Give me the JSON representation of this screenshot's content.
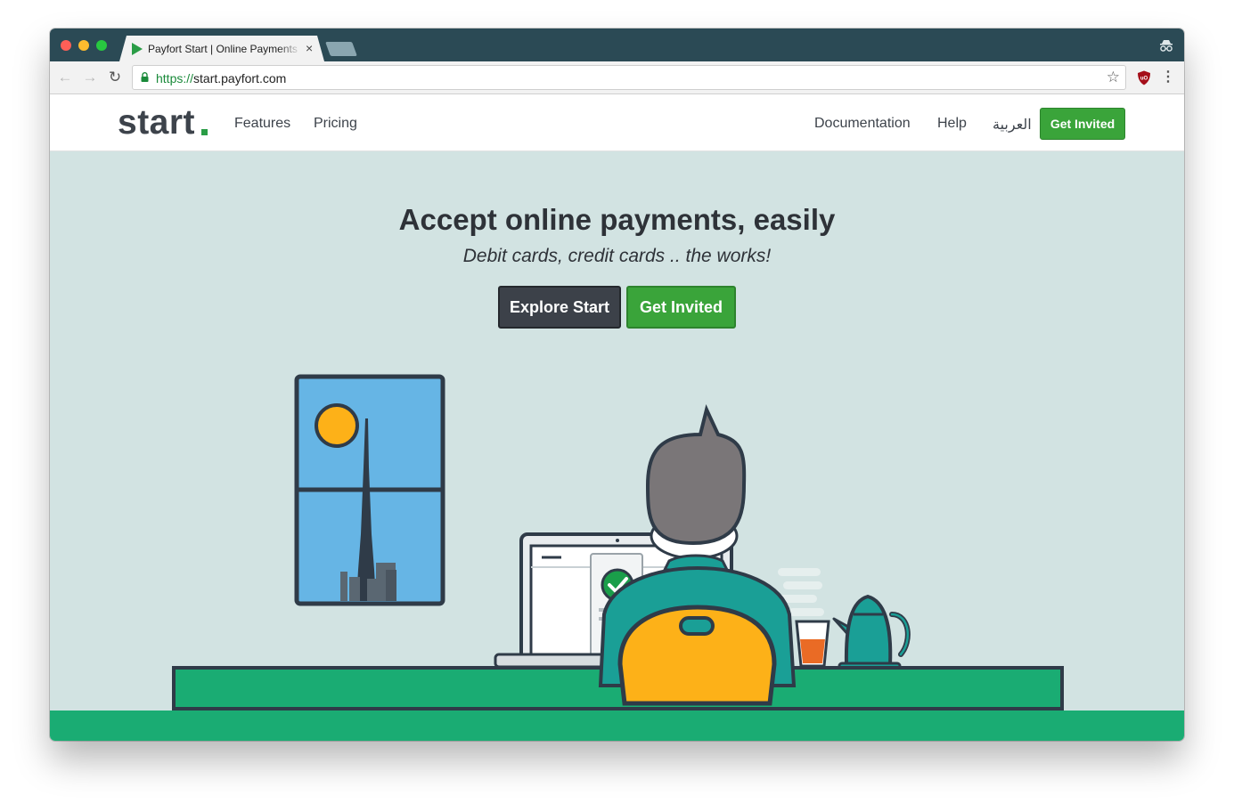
{
  "browser": {
    "tab_title": "Payfort Start | Online Payments",
    "tab_close": "×",
    "url_scheme": "https://",
    "url_host": "start.payfort.com",
    "icons": [
      "back-arrow-icon",
      "forward-arrow-icon",
      "reload-icon",
      "lock-icon",
      "bookmark-star-icon",
      "ublock-icon",
      "menu-icon",
      "incognito-icon"
    ]
  },
  "header": {
    "logo": "start",
    "nav": {
      "features": "Features",
      "pricing": "Pricing",
      "documentation": "Documentation",
      "help": "Help",
      "arabic": "العربية"
    },
    "cta": "Get Invited"
  },
  "hero": {
    "title": "Accept online payments, easily",
    "subtitle": "Debit cards, credit cards .. the works!",
    "explore_button": "Explore Start",
    "invite_button": "Get Invited"
  },
  "colors": {
    "tabstrip": "#2b4a55",
    "hero_bg": "#d2e3e2",
    "green": "#3aa43a",
    "dark": "#3c4149",
    "desk": "#1aac73",
    "teal": "#1a9f96",
    "yellow": "#fdb118",
    "sky": "#66b5e5"
  }
}
